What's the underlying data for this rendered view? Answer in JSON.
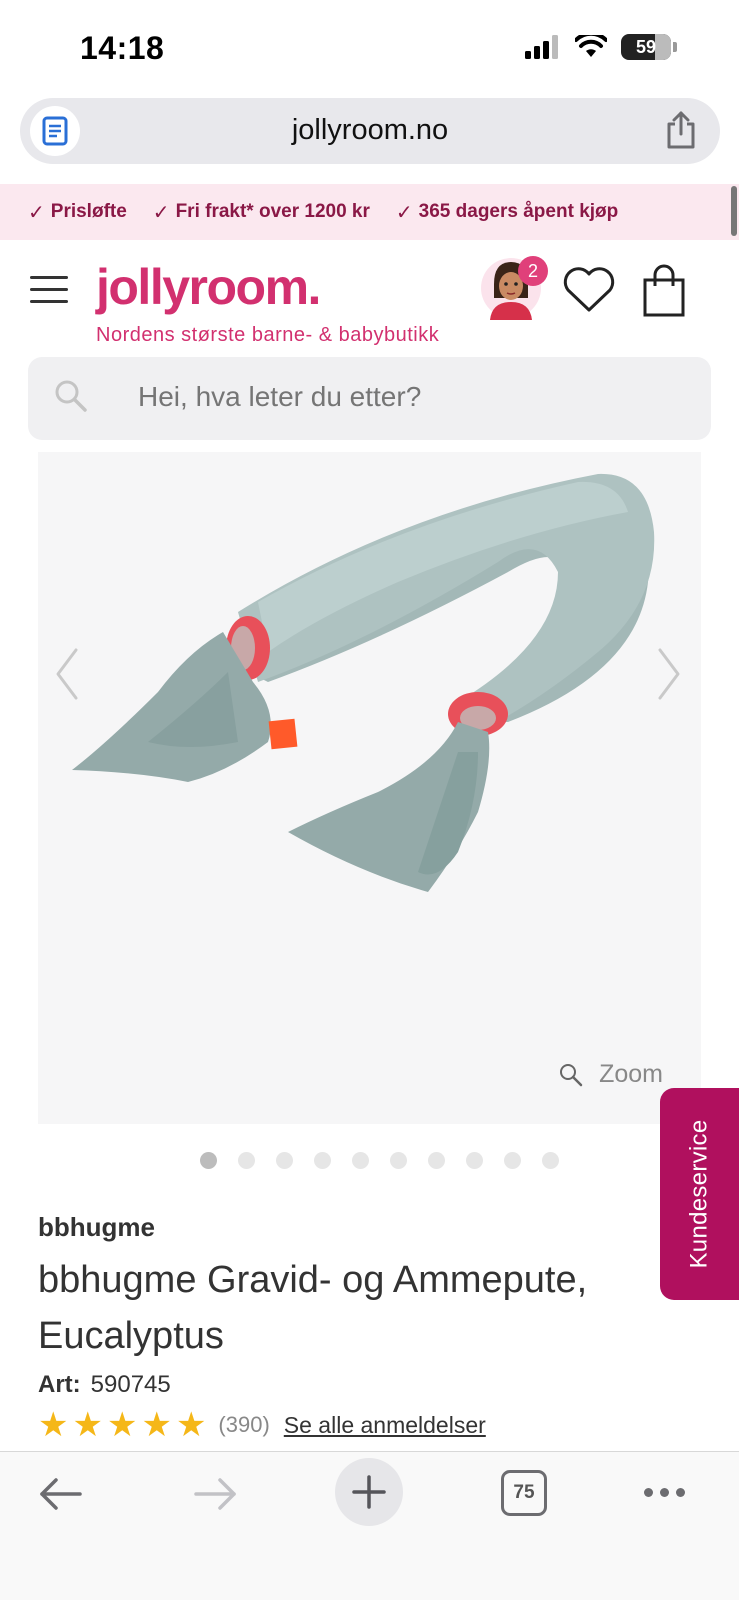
{
  "status_bar": {
    "time": "14:18",
    "battery": "59"
  },
  "browser": {
    "url": "jollyroom.no"
  },
  "usp_banner": {
    "items": [
      "Prisløfte",
      "Fri frakt* over 1200 kr",
      "365 dagers åpent kjøp"
    ]
  },
  "header": {
    "logo": "jollyroom.",
    "tagline": "Nordens største barne- & babybutikk",
    "notification_count": "2"
  },
  "search": {
    "placeholder": "Hei, hva leter du etter?"
  },
  "gallery": {
    "zoom_label": "Zoom",
    "image_count": 10,
    "active_index": 0
  },
  "customer_service": {
    "label": "Kundeservice"
  },
  "product": {
    "brand": "bbhugme",
    "title": "bbhugme Gravid- og Ammepute, Eucalyptus",
    "art_label": "Art:",
    "art_number": "590745",
    "rating": 5,
    "review_count": "(390)",
    "see_reviews": "Se alle anmeldelser"
  },
  "toolbar": {
    "tab_count": "75"
  },
  "colors": {
    "brand_pink": "#d2306f",
    "usp_background": "#fbe8ef",
    "customer_service_bg": "#b0105e",
    "star": "#f5b718",
    "pillow": "#a8bcbb"
  }
}
